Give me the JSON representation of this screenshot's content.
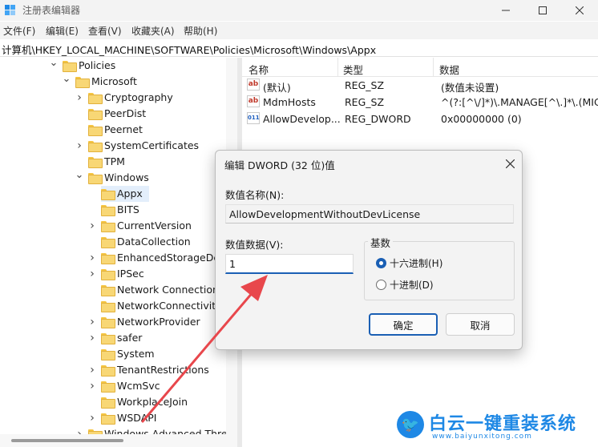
{
  "window": {
    "title": "注册表编辑器"
  },
  "menu": [
    "文件(F)",
    "编辑(E)",
    "查看(V)",
    "收藏夹(A)",
    "帮助(H)"
  ],
  "address": "计算机\\HKEY_LOCAL_MACHINE\\SOFTWARE\\Policies\\Microsoft\\Windows\\Appx",
  "tree": {
    "items": [
      {
        "label": "Policies",
        "expanded": true
      },
      {
        "label": "Microsoft",
        "expanded": true
      },
      {
        "label": "Cryptography"
      },
      {
        "label": "PeerDist"
      },
      {
        "label": "Peernet"
      },
      {
        "label": "SystemCertificates"
      },
      {
        "label": "TPM"
      },
      {
        "label": "Windows",
        "expanded": true
      },
      {
        "label": "Appx",
        "selected": true
      },
      {
        "label": "BITS"
      },
      {
        "label": "CurrentVersion"
      },
      {
        "label": "DataCollection"
      },
      {
        "label": "EnhancedStorageDevic"
      },
      {
        "label": "IPSec"
      },
      {
        "label": "Network Connections"
      },
      {
        "label": "NetworkConnectivitySta"
      },
      {
        "label": "NetworkProvider"
      },
      {
        "label": "safer"
      },
      {
        "label": "System"
      },
      {
        "label": "TenantRestrictions"
      },
      {
        "label": "WcmSvc"
      },
      {
        "label": "WorkplaceJoin"
      },
      {
        "label": "WSDAPI"
      },
      {
        "label": "Windows Advanced Threat"
      }
    ]
  },
  "list": {
    "headers": {
      "name": "名称",
      "type": "类型",
      "data": "数据"
    },
    "rows": [
      {
        "icon": "ab",
        "name": "(默认)",
        "type": "REG_SZ",
        "data": "(数值未设置)"
      },
      {
        "icon": "ab",
        "name": "MdmHosts",
        "type": "REG_SZ",
        "data": "^(?:[^\\/]*)\\.MANAGE[^\\.]*\\.(MICR"
      },
      {
        "icon": "bin",
        "name": "AllowDevelop...",
        "type": "REG_DWORD",
        "data": "0x00000000 (0)"
      }
    ]
  },
  "dialog": {
    "title": "编辑 DWORD (32 位)值",
    "name_label": "数值名称(N):",
    "name_value": "AllowDevelopmentWithoutDevLicense",
    "data_label": "数值数据(V):",
    "data_value": "1",
    "base_title": "基数",
    "radio_hex": "十六进制(H)",
    "radio_dec": "十进制(D)",
    "ok": "确定",
    "cancel": "取消"
  },
  "watermark": {
    "text": "白云一键重装系统",
    "url": "www.baiyunxitong.com"
  },
  "colors": {
    "accent": "#1a5fb4",
    "arrow": "#e8474c",
    "selection": "#e3eefb"
  },
  "icons": {
    "app": "regedit-icon",
    "close": "close-icon",
    "folder": "folder-icon",
    "chevron_right": "chevron-right-icon",
    "chevron_down": "chevron-down-icon"
  }
}
